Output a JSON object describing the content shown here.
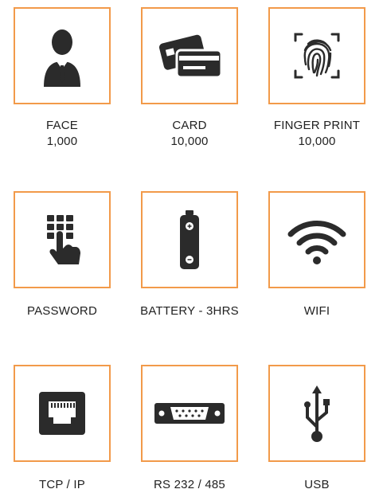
{
  "accent_color": "#f29a4a",
  "icon_color": "#2b2b2b",
  "features": [
    {
      "label": "FACE",
      "value": "1,000",
      "icon": "businessman-icon"
    },
    {
      "label": "CARD",
      "value": "10,000",
      "icon": "cards-icon"
    },
    {
      "label": "FINGER PRINT",
      "value": "10,000",
      "icon": "fingerprint-icon"
    },
    {
      "label": "PASSWORD",
      "icon": "keypad-hand-icon"
    },
    {
      "label": "BATTERY - 3HRS",
      "icon": "battery-icon"
    },
    {
      "label": "WIFI",
      "icon": "wifi-icon"
    },
    {
      "label": "TCP / IP",
      "icon": "ethernet-port-icon"
    },
    {
      "label": "RS 232 / 485",
      "icon": "serial-port-icon"
    },
    {
      "label": "USB",
      "icon": "usb-icon"
    }
  ]
}
